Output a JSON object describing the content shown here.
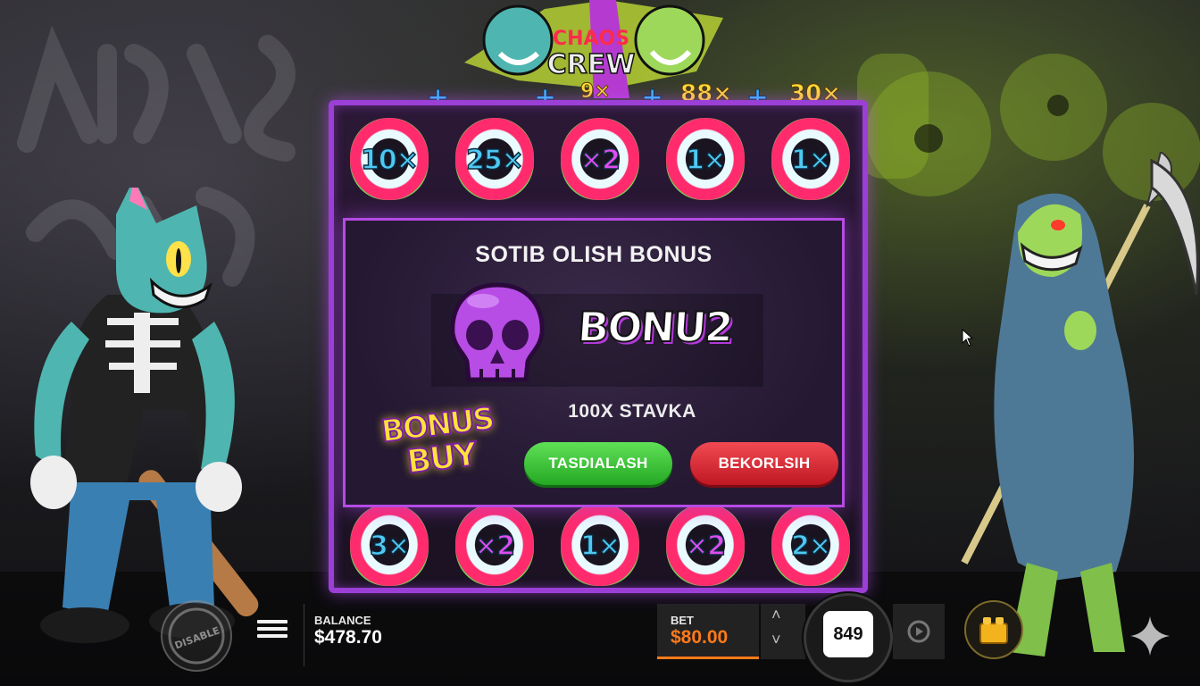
{
  "game": {
    "logo_lines": [
      "CHAOS",
      "CREW"
    ]
  },
  "reels": {
    "multipliers": [
      {
        "column": 1,
        "type": "plus",
        "text": "+"
      },
      {
        "column": 2,
        "type": "plus",
        "text": "+"
      },
      {
        "column": 3,
        "type": "mult",
        "text": "9×"
      },
      {
        "column": 4,
        "type": "mult",
        "text": "88×"
      },
      {
        "column": 5,
        "type": "mult",
        "text": "30×"
      }
    ],
    "between_plus": [
      "+",
      "+",
      "+"
    ],
    "top_row": [
      "10×",
      "25×",
      "×2",
      "1×",
      "1×"
    ],
    "bottom_row": [
      "3×",
      "×2",
      "1×",
      "×2",
      "2×"
    ]
  },
  "modal": {
    "title": "SOTIB OLISH BONUS",
    "feature_name": "BONU2",
    "price": "100X STAVKA",
    "bonus_buy_logo": [
      "BONUS",
      "BUY"
    ],
    "confirm_label": "TASDIALASH",
    "cancel_label": "BEKORLSIH"
  },
  "bottom_bar": {
    "disable_label": "DISABLE",
    "balance_label": "BALANCE",
    "balance_value": "$478.70",
    "bet_label": "BET",
    "bet_value": "$80.00",
    "spin_counter": "849"
  },
  "colors": {
    "frame": "#9b3fd6",
    "confirm": "#25a824",
    "cancel": "#c01824",
    "bet_accent": "#ff7a1a",
    "multiplier": "#ffdd35",
    "plus": "#35b8ff"
  }
}
